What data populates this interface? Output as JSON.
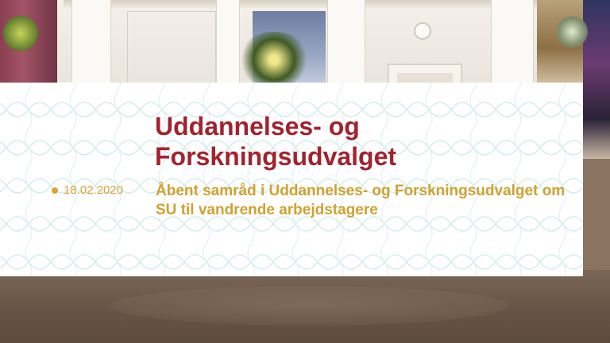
{
  "video": {
    "committee": "Uddannelses- og Forskningsudvalget",
    "date": "18.02.2020",
    "description": "Åbent samråd i Uddannelses- og Forskningsudvalget om SU til vandrende arbejdstagere"
  },
  "colors": {
    "title": "#a1232e",
    "accent": "#d9a531",
    "banner_bg": "#ffffff",
    "pattern": "#d6ecec"
  },
  "icons": {
    "date_marker": "bullet-dot"
  }
}
